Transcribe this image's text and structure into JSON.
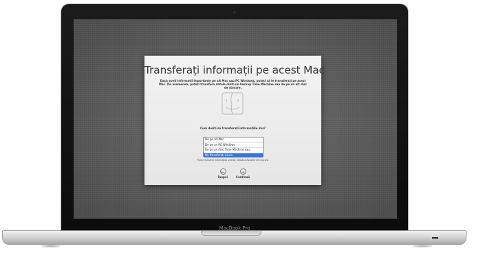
{
  "device": {
    "brand_label": "MacBook Pro"
  },
  "assistant": {
    "title": "Transferați informații pe acest Mac",
    "description": "Dacă aveți informații importante pe alt Mac sau PC Windows, puteți să le transferați pe acest Mac. De asemenea, puteți transfera datele dintr-un backup Time Machine sau de pe un alt disc de stocare.",
    "question": "Cum doriți să transferați informațiile dvs?",
    "options": [
      {
        "label": "De pe alt Mac",
        "selected": false
      },
      {
        "label": "De pe un PC Windows",
        "selected": false
      },
      {
        "label": "De pe un disc Time Machine sau...",
        "selected": false
      },
      {
        "label": "Nu transferați acum",
        "selected": true
      }
    ],
    "note": "Puteți transfera informațiile ulterior utilizând Asistent de migrare.",
    "back_label": "Înapoi",
    "continue_label": "Continuă",
    "back_icon": "arrow-left-icon",
    "continue_icon": "arrow-right-icon"
  },
  "colors": {
    "selection": "#3875d7",
    "desktop": "#5b5b5b",
    "bezel": "#111111"
  }
}
